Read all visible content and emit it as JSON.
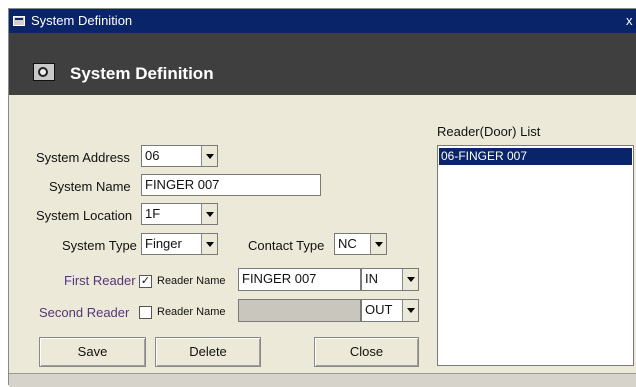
{
  "window": {
    "title": "System Definition",
    "close_glyph": "x"
  },
  "header": {
    "title": "System Definition",
    "icon": "system-icon"
  },
  "form": {
    "system_address_label": "System Address",
    "system_address_value": "06",
    "system_name_label": "System Name",
    "system_name_value": "FINGER 007",
    "system_location_label": "System Location",
    "system_location_value": "1F",
    "system_type_label": "System Type",
    "system_type_value": "Finger",
    "contact_type_label": "Contact Type",
    "contact_type_value": "NC",
    "first_reader_label": "First Reader",
    "first_reader_checked": "✓",
    "first_reader_name_label": "Reader Name",
    "first_reader_name_value": "FINGER 007",
    "first_reader_direction": "IN",
    "second_reader_label": "Second Reader",
    "second_reader_name_label": "Reader Name",
    "second_reader_name_value": "",
    "second_reader_direction": "OUT"
  },
  "reader_list": {
    "label": "Reader(Door) List",
    "items": [
      {
        "label": "06-FINGER 007",
        "selected": true
      }
    ]
  },
  "buttons": {
    "save": "Save",
    "delete": "Delete",
    "close": "Close"
  },
  "colors": {
    "title_bar": "#0a246a",
    "header": "#3f3f3f",
    "accent_label": "#55357a",
    "selection": "#0a246a"
  }
}
